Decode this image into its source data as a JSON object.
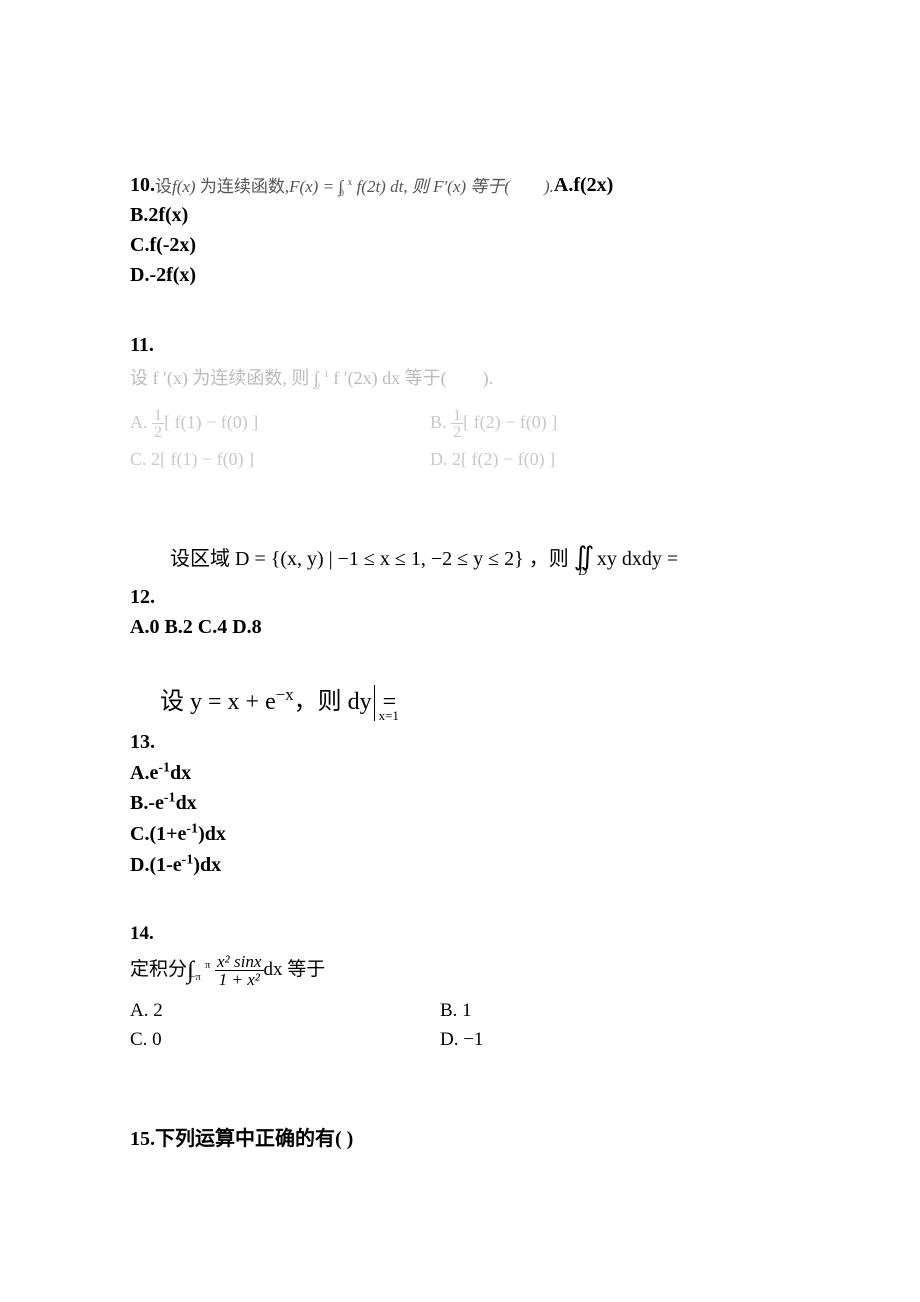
{
  "q10": {
    "num": "10.",
    "stem_pre": "设",
    "stem_fx": "f(x)",
    "stem_mid": " 为连续函数,",
    "stem_Fx": "F(x) = ∫",
    "stem_Fx2": " f(2t) dt, 则 F′(x) 等于(　　).",
    "limlow": "0",
    "limup": "x",
    "A": "A.f(2x)",
    "B": "B.2f(x)",
    "C": "C.f(-2x)",
    "D": "D.-2f(x)"
  },
  "q11": {
    "num": "11.",
    "stem_pre": "设 f ′(x) 为连续函数, 则 ∫",
    "stem_mid": " f ′(2x) dx 等于(　　).",
    "limlow": "0",
    "limup": "1",
    "A_pre": "A. ",
    "A_main": "[ f(1) − f(0) ]",
    "B_pre": "B. ",
    "B_main": "[ f(2) − f(0) ]",
    "C": "C. 2[ f(1) − f(0) ]",
    "D": "D. 2[ f(2) − f(0) ]",
    "half_num": "1",
    "half_den": "2"
  },
  "q12": {
    "stem_pre": "设区域 D = {(x, y) | −1 ≤ x ≤ 1, −2 ≤ y ≤ 2} ，则 ",
    "stem_iint": "∬",
    "stem_sub": "D",
    "stem_post": "xy dxdy =",
    "num": "12.",
    "opts": "A.0 B.2 C.4 D.8"
  },
  "q13": {
    "stem_pre": "设 y = x + e",
    "stem_exp": "−x",
    "stem_mid": "，则 dy",
    "stem_sub": "x=1",
    "stem_post": " =",
    "num": "13.",
    "A_pre": "A.e",
    "A_exp": "-1",
    "A_post": "dx",
    "B_pre": "B.-e",
    "B_exp": "-1",
    "B_post": "dx",
    "C_pre": "C.(1+e",
    "C_exp": "-1",
    "C_post": ")dx",
    "D_pre": "D.(1-e",
    "D_exp": "-1",
    "D_post": ")dx"
  },
  "q14": {
    "num": "14.",
    "stem_pre": "定积分",
    "limlow": "−π",
    "limup": "π",
    "frac_num": "x² sinx",
    "frac_den": "1 + x²",
    "stem_post": "dx 等于",
    "A": "A. 2",
    "B": "B. 1",
    "C": "C. 0",
    "D": "D. −1"
  },
  "q15": {
    "num": "15.",
    "stem": "下列运算中正确的有( )"
  }
}
